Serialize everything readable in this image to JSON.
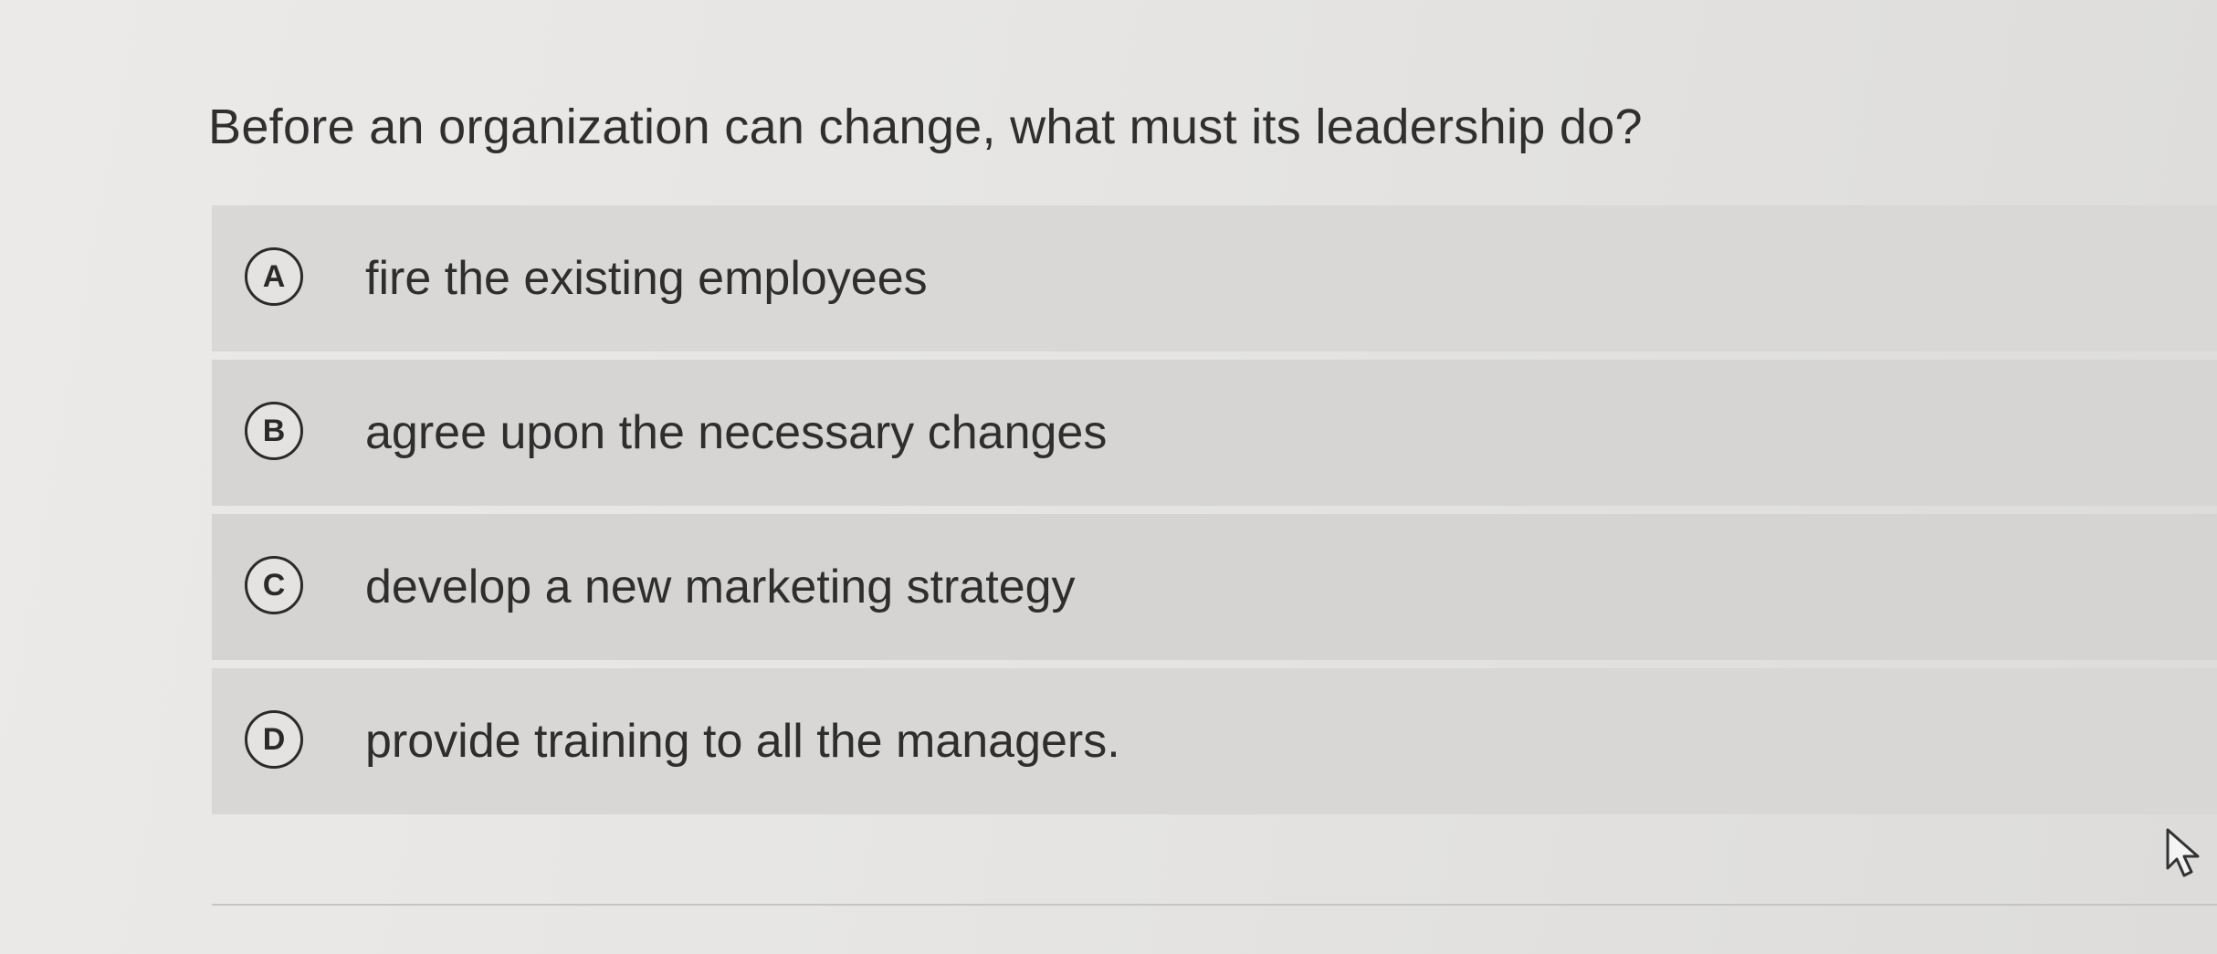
{
  "question": {
    "text": "Before an organization can change, what must its leadership do?"
  },
  "options": [
    {
      "letter": "A",
      "text": "fire the existing employees"
    },
    {
      "letter": "B",
      "text": "agree upon the necessary changes"
    },
    {
      "letter": "C",
      "text": "develop a new marketing strategy"
    },
    {
      "letter": "D",
      "text": "provide training to all the managers."
    }
  ],
  "icons": {
    "cursor": "mouse-pointer-icon"
  }
}
